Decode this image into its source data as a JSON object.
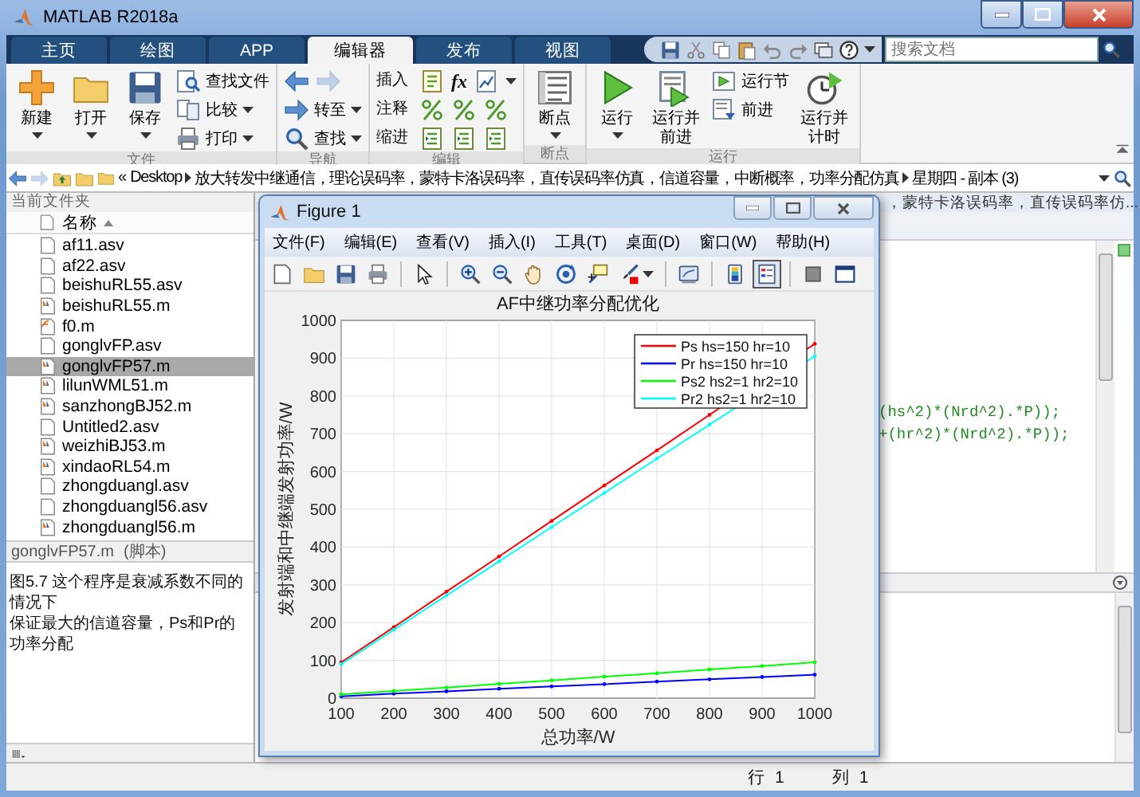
{
  "window": {
    "title": "MATLAB R2018a"
  },
  "tabs": [
    {
      "label": "主页",
      "selected": false
    },
    {
      "label": "绘图",
      "selected": false
    },
    {
      "label": "APP",
      "selected": false
    },
    {
      "label": "编辑器",
      "selected": true
    },
    {
      "label": "发布",
      "selected": false
    },
    {
      "label": "视图",
      "selected": false
    }
  ],
  "search": {
    "placeholder": "搜索文档"
  },
  "toolstrip": {
    "groups": [
      {
        "label": "文件",
        "items": [
          {
            "kind": "large",
            "label": "新建",
            "dropdown": true
          },
          {
            "kind": "large",
            "label": "打开",
            "dropdown": true
          },
          {
            "kind": "large",
            "label": "保存",
            "dropdown": true
          },
          {
            "kind": "small",
            "label": "查找文件",
            "dropdown": false
          },
          {
            "kind": "small",
            "label": "比较",
            "dropdown": true
          },
          {
            "kind": "small",
            "label": "打印",
            "dropdown": true
          }
        ]
      },
      {
        "label": "导航",
        "items": [
          {
            "kind": "pair",
            "back_disabled": false,
            "forward_disabled": true
          },
          {
            "kind": "small",
            "label": "转至",
            "dropdown": true
          },
          {
            "kind": "small",
            "label": "查找",
            "dropdown": true
          }
        ]
      },
      {
        "label": "编辑",
        "items": [
          {
            "kind": "iconrow",
            "label": "插入",
            "symbol": "fx",
            "dropdown": true
          },
          {
            "kind": "iconrow",
            "label": "注释",
            "dropdown": false
          },
          {
            "kind": "iconrow",
            "label": "缩进",
            "dropdown": false
          }
        ]
      },
      {
        "label": "断点",
        "items": [
          {
            "kind": "large",
            "label": "断点",
            "dropdown": true
          }
        ]
      },
      {
        "label": "运行",
        "items": [
          {
            "kind": "large",
            "label": "运行",
            "dropdown": true
          },
          {
            "kind": "large",
            "label": "运行并前进",
            "dropdown": false
          },
          {
            "kind": "small",
            "label": "运行节",
            "dropdown": false
          },
          {
            "kind": "small",
            "label": "前进",
            "dropdown": false
          },
          {
            "kind": "large",
            "label": "运行并计时",
            "dropdown": false
          }
        ]
      }
    ]
  },
  "address": {
    "overflow": "«",
    "segments": [
      "Desktop",
      "放大转发中继通信，理论误码率，蒙特卡洛误码率，直传误码率仿真，信道容量，中断概率，功率分配仿真",
      "星期四 - 副本 (3)"
    ]
  },
  "current_folder": {
    "title": "当前文件夹",
    "column": "名称",
    "sorted_ascending": true,
    "files": [
      {
        "name": "af11.asv",
        "kind": "text",
        "selected": false
      },
      {
        "name": "af22.asv",
        "kind": "text",
        "selected": false
      },
      {
        "name": "beishuRL55.asv",
        "kind": "text",
        "selected": false
      },
      {
        "name": "beishuRL55.m",
        "kind": "script",
        "selected": false
      },
      {
        "name": "f0.m",
        "kind": "function",
        "selected": false
      },
      {
        "name": "gonglvFP.asv",
        "kind": "text",
        "selected": false
      },
      {
        "name": "gonglvFP57.m",
        "kind": "script",
        "selected": true
      },
      {
        "name": "lilunWML51.m",
        "kind": "script",
        "selected": false
      },
      {
        "name": "sanzhongBJ52.m",
        "kind": "script",
        "selected": false
      },
      {
        "name": "Untitled2.asv",
        "kind": "text",
        "selected": false
      },
      {
        "name": "weizhiBJ53.m",
        "kind": "script",
        "selected": false
      },
      {
        "name": "xindaoRL54.m",
        "kind": "script",
        "selected": false
      },
      {
        "name": "zhongduangl.asv",
        "kind": "text",
        "selected": false
      },
      {
        "name": "zhongduangl56.asv",
        "kind": "text",
        "selected": false
      },
      {
        "name": "zhongduangl56.m",
        "kind": "script",
        "selected": false
      }
    ],
    "details": {
      "name": "gonglvFP57.m",
      "type": "(脚本)"
    },
    "description_lines": [
      "图5.7 这个程序是衰减系数不同的情况下",
      "保证最大的信道容量，Ps和Pr的功率分配"
    ]
  },
  "editor": {
    "tab_title": "，蒙特卡洛误码率，直传误码率仿...",
    "code_lines": [
      "(hs^2)*(Nrd^2).*P));",
      "+(hr^2)*(Nrd^2).*P));"
    ]
  },
  "figure": {
    "title": "Figure 1",
    "menu": [
      "文件(F)",
      "编辑(E)",
      "查看(V)",
      "插入(I)",
      "工具(T)",
      "桌面(D)",
      "窗口(W)",
      "帮助(H)"
    ],
    "toolbar": [
      {
        "pressed": false
      },
      {
        "pressed": false
      },
      {
        "pressed": false
      },
      {
        "pressed": false
      },
      {
        "pressed": false
      },
      {
        "pressed": false
      },
      {
        "pressed": false
      },
      {
        "pressed": false
      },
      {
        "pressed": false
      },
      {
        "pressed": false
      },
      {
        "pressed": false
      },
      {
        "pressed": false
      },
      {
        "pressed": false
      },
      {
        "pressed": true
      },
      {
        "pressed": false
      },
      {
        "pressed": false
      }
    ],
    "chart_data": {
      "type": "line",
      "title": "AF中继功率分配优化",
      "xlabel": "总功率/W",
      "ylabel": "发射端和中继端发射功率/W",
      "x": [
        100,
        200,
        300,
        400,
        500,
        600,
        700,
        800,
        900,
        1000
      ],
      "series": [
        {
          "name": "Ps hs=150 hr=10",
          "color": "#ff0000",
          "values": [
            95,
            188,
            282,
            375,
            469,
            563,
            656,
            750,
            null,
            938
          ]
        },
        {
          "name": "Pr hs=150 hr=10",
          "color": "#0000ff",
          "values": [
            5,
            12,
            18,
            25,
            31,
            37,
            44,
            50,
            56,
            62
          ]
        },
        {
          "name": "Ps2 hs2=1 hr2=10",
          "color": "#00ff00",
          "values": [
            10,
            19,
            28,
            38,
            47,
            57,
            66,
            76,
            85,
            95
          ]
        },
        {
          "name": "Pr2 hs2=1 hr2=10",
          "color": "#00ffff",
          "values": [
            90,
            181,
            272,
            362,
            453,
            543,
            634,
            724,
            null,
            905
          ]
        }
      ],
      "grid": true,
      "legend": true,
      "xlim": [
        100,
        1000
      ],
      "ylim": [
        0,
        1000
      ],
      "xticks": [
        100,
        200,
        300,
        400,
        500,
        600,
        700,
        800,
        900,
        1000
      ],
      "yticks": [
        0,
        100,
        200,
        300,
        400,
        500,
        600,
        700,
        800,
        900,
        1000
      ]
    }
  },
  "status_bar": {
    "row_label": "行",
    "row": "1",
    "col_label": "列",
    "col": "1"
  }
}
